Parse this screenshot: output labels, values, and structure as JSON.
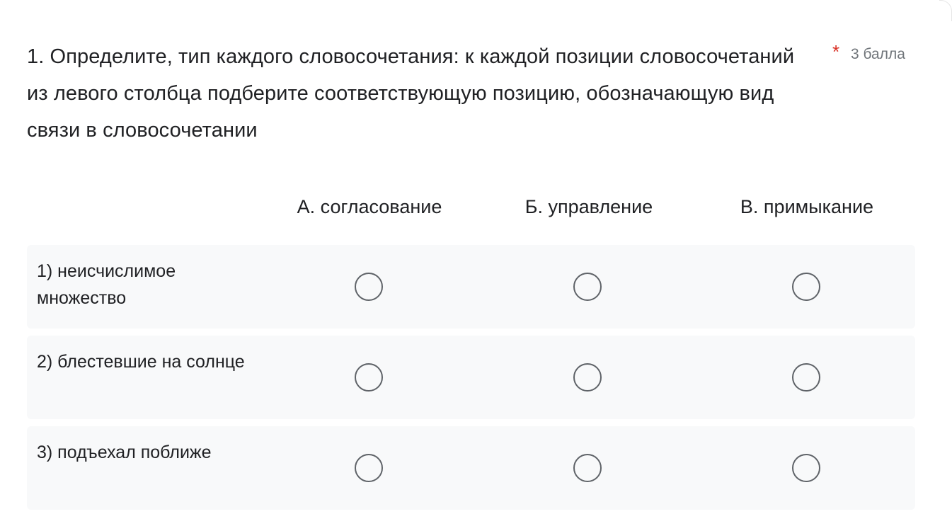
{
  "question": {
    "title": "1. Определите, тип каждого словосочетания: к каждой позиции словосочетаний из левого столбца подберите соответствующую позицию, обозначающую вид связи в словосочетании",
    "required_mark": "*",
    "points": "3 балла"
  },
  "columns": [
    "А. согласование",
    "Б. управление",
    "В. примыкание"
  ],
  "rows": [
    {
      "label": "1) неисчислимое множество"
    },
    {
      "label": "2) блестевшие на солнце"
    },
    {
      "label": "3) подъехал поближе"
    }
  ],
  "colors": {
    "required": "#d93025",
    "row_background": "#f8f9fa",
    "radio_border": "#5f6368"
  }
}
